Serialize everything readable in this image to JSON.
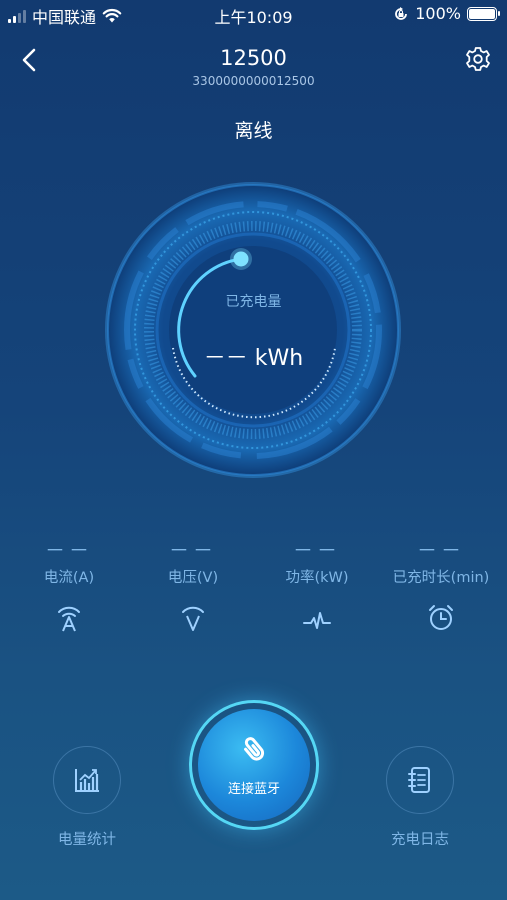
{
  "status_bar": {
    "carrier": "中国联通",
    "time": "上午10:09",
    "battery": "100%"
  },
  "header": {
    "title": "12500",
    "subtitle": "3300000000012500",
    "state": "离线"
  },
  "gauge": {
    "label": "已充电量",
    "value": "－－ kWh"
  },
  "metrics": [
    {
      "value": "－－",
      "label": "电流(A)",
      "icon": "current-icon"
    },
    {
      "value": "－－",
      "label": "电压(V)",
      "icon": "voltage-icon"
    },
    {
      "value": "－－",
      "label": "功率(kW)",
      "icon": "power-icon"
    },
    {
      "value": "－－",
      "label": "已充时长(min)",
      "icon": "alarm-clock-icon"
    }
  ],
  "bottom": {
    "left_label": "电量统计",
    "center_label": "连接蓝牙",
    "right_label": "充电日志"
  },
  "colors": {
    "accent": "#55d7f5",
    "label": "#7fb6e6",
    "background": "#15447a"
  }
}
